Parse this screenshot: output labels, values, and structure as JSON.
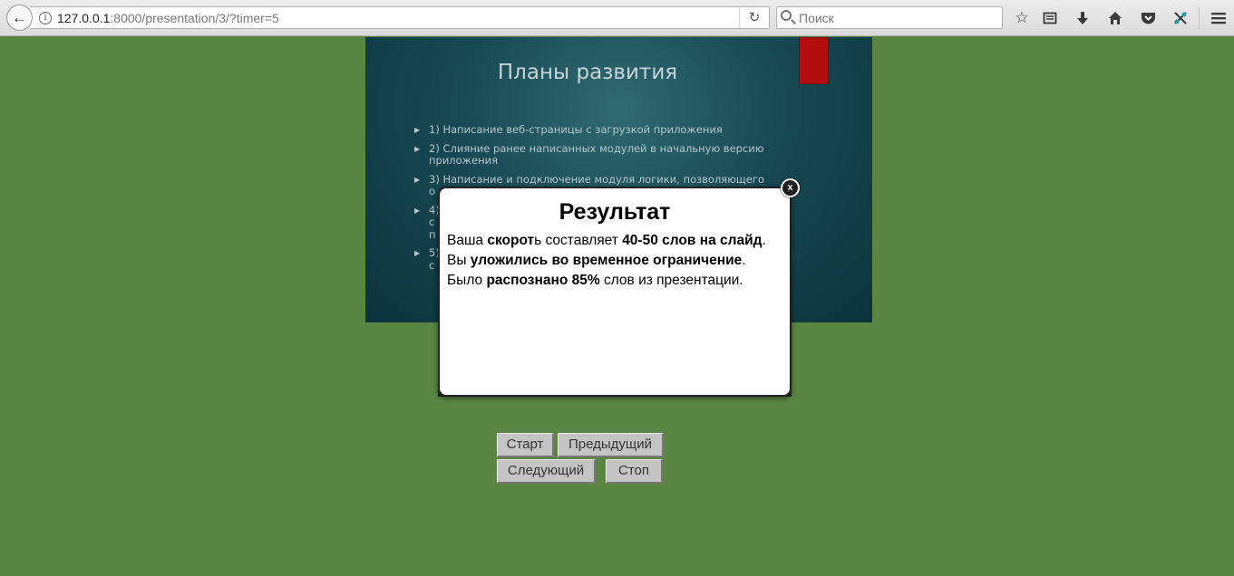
{
  "browser": {
    "url_host": "127.0.0.1",
    "url_path": ":8000/presentation/3/?timer=5",
    "search_placeholder": "Поиск",
    "back_glyph": "←",
    "info_glyph": "i",
    "reload_glyph": "↻",
    "icons": [
      "bookmark-star-icon",
      "reading-list-icon",
      "download-icon",
      "home-icon",
      "pocket-icon",
      "extension-icon",
      "menu-icon"
    ]
  },
  "slide": {
    "title": "Планы развития",
    "items": [
      "1) Написание веб-страницы с загрузкой приложения",
      "2) Слияние ранее написанных модулей в начальную версию приложения",
      "3) Написание и подключение модуля логики, позволяющего о",
      "4)\nс\nп",
      "5)\nс"
    ]
  },
  "modal": {
    "title": "Результат",
    "close_label": "x",
    "line1": {
      "a": "Ваша ",
      "b": "скорот",
      "c": "ь составляет ",
      "d": "40-50 слов на слайд",
      "e": "."
    },
    "line2": {
      "a": "Вы ",
      "b": "уложились во временное ограничение",
      "c": "."
    },
    "line3": {
      "a": "Было ",
      "b": "распознано 85%",
      "c": " слов из презентации."
    }
  },
  "controls": {
    "start": "Старт",
    "prev": "Предыдущий",
    "next": "Следующий",
    "stop": "Стоп"
  },
  "colors": {
    "page_background": "#5b8543",
    "slide_background": "#174954",
    "slide_accent": "#b20e0e"
  }
}
